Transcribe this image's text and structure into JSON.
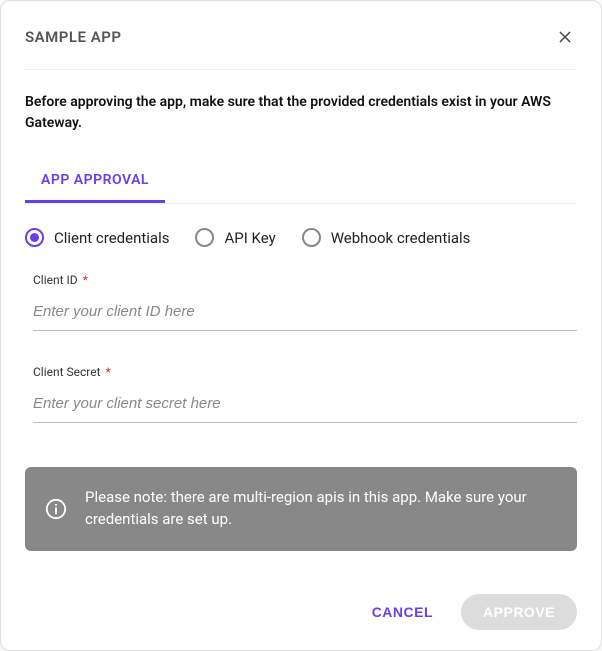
{
  "header": {
    "title": "SAMPLE APP"
  },
  "notice": "Before approving the app, make sure that the provided credentials exist in your AWS Gateway.",
  "tabs": {
    "approval_label": "APP APPROVAL"
  },
  "radios": {
    "client_credentials": "Client credentials",
    "api_key": "API Key",
    "webhook": "Webhook credentials"
  },
  "fields": {
    "client_id": {
      "label": "Client ID",
      "required_mark": "*",
      "placeholder": "Enter your client ID here",
      "value": ""
    },
    "client_secret": {
      "label": "Client Secret",
      "required_mark": "*",
      "placeholder": "Enter your client secret here",
      "value": ""
    }
  },
  "alert": {
    "text": "Please note: there are multi-region apis in this app. Make sure your credentials are set up."
  },
  "footer": {
    "cancel": "CANCEL",
    "approve": "APPROVE"
  }
}
